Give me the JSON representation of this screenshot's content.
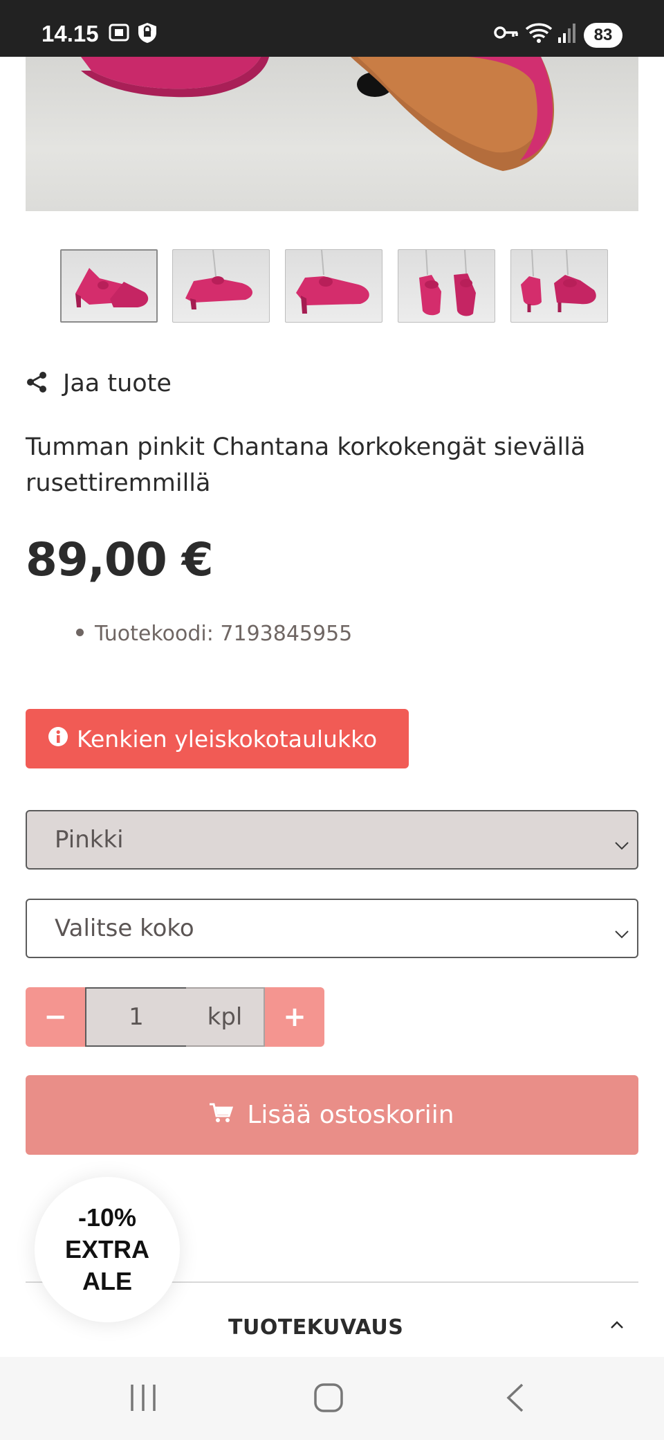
{
  "status_bar": {
    "time": "14.15",
    "battery": "83",
    "icons": [
      "screenshot-icon",
      "shield-icon",
      "key-icon",
      "wifi-icon",
      "signal-icon"
    ]
  },
  "product": {
    "share_label": "Jaa tuote",
    "title": "Tumman pinkit Chantana korkokengät sievällä rusettiremmillä",
    "price": "89,00 €",
    "code": "Tuotekoodi: 7193845955",
    "thumbnail_count": 5,
    "selected_thumbnail": 1
  },
  "size_chart_button": {
    "label": "Kenkien yleiskokotaulukko"
  },
  "selects": {
    "color_value": "Pinkki",
    "size_placeholder": "Valitse koko"
  },
  "quantity": {
    "minus": "−",
    "value": "1",
    "unit": "kpl",
    "plus": "+"
  },
  "add_to_cart": {
    "label": "Lisää ostoskoriin"
  },
  "promo": {
    "line1": "-10%",
    "line2": "EXTRA",
    "line3": "ALE"
  },
  "description": {
    "heading": "TUOTEKUVAUS"
  },
  "colors": {
    "accent_red": "#f15b55",
    "add_cart_bg": "#e98e88",
    "qty_button_bg": "#f49590",
    "select_bg": "#ddd7d6",
    "shoe_pink": "#d42d6c"
  }
}
